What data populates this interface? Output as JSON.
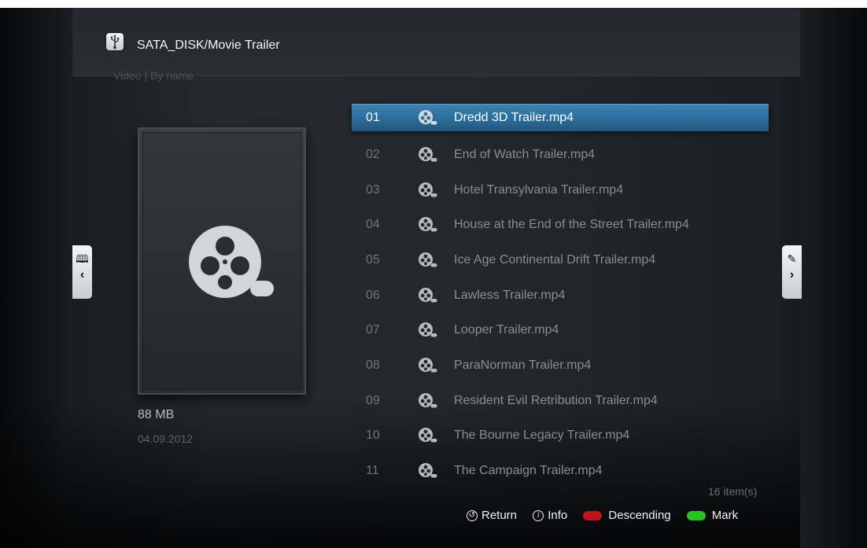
{
  "header": {
    "path": "SATA_DISK/Movie Trailer",
    "sort": "Video | By name",
    "icon": "usb-icon"
  },
  "preview": {
    "size": "88 MB",
    "date": "04.09.2012",
    "icon": "film-reel-icon"
  },
  "list": {
    "items": [
      {
        "num": "01",
        "name": "Dredd 3D Trailer.mp4",
        "selected": true
      },
      {
        "num": "02",
        "name": "End of Watch Trailer.mp4"
      },
      {
        "num": "03",
        "name": "Hotel Transylvania Trailer.mp4"
      },
      {
        "num": "04",
        "name": "House at the End of the Street Trailer.mp4"
      },
      {
        "num": "05",
        "name": "Ice Age Continental Drift Trailer.mp4"
      },
      {
        "num": "06",
        "name": "Lawless Trailer.mp4"
      },
      {
        "num": "07",
        "name": "Looper Trailer.mp4"
      },
      {
        "num": "08",
        "name": "ParaNorman Trailer.mp4"
      },
      {
        "num": "09",
        "name": "Resident Evil Retribution Trailer.mp4"
      },
      {
        "num": "10",
        "name": "The Bourne Legacy Trailer.mp4"
      },
      {
        "num": "11",
        "name": "The Campaign Trailer.mp4"
      }
    ],
    "count": "16 item(s)"
  },
  "side_tabs": {
    "left": {
      "icon": "book-icon",
      "glyph": "🕮",
      "chevron": "‹"
    },
    "right": {
      "icon": "edit-icon",
      "glyph": "✎",
      "chevron": "›"
    }
  },
  "footer": {
    "return_label": "Return",
    "info_label": "Info",
    "descending_label": "Descending",
    "mark_label": "Mark",
    "colors": {
      "red": "#c0141c",
      "green": "#27c41b"
    }
  },
  "colors": {
    "selection": "#2c6e9c"
  }
}
